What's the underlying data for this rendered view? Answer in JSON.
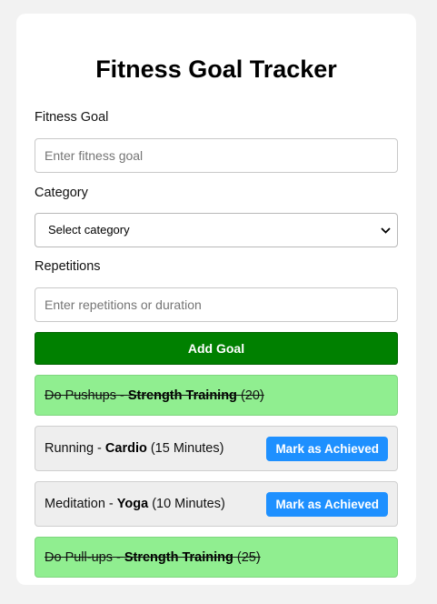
{
  "app": {
    "title": "Fitness Goal Tracker"
  },
  "form": {
    "goal_label": "Fitness Goal",
    "goal_placeholder": "Enter fitness goal",
    "goal_value": "",
    "category_label": "Category",
    "category_selected": "Select category",
    "repetitions_label": "Repetitions",
    "repetitions_placeholder": "Enter repetitions or duration",
    "repetitions_value": "",
    "add_button_label": "Add Goal"
  },
  "goals": [
    {
      "name": "Do Pushups",
      "sep": " - ",
      "category": "Strength Training",
      "amount": " (20)",
      "achieved": true,
      "action_label": ""
    },
    {
      "name": "Running",
      "sep": " - ",
      "category": "Cardio",
      "amount": " (15 Minutes)",
      "achieved": false,
      "action_label": "Mark as Achieved"
    },
    {
      "name": "Meditation",
      "sep": " - ",
      "category": "Yoga",
      "amount": " (10 Minutes)",
      "achieved": false,
      "action_label": "Mark as Achieved"
    },
    {
      "name": "Do Pull-ups",
      "sep": " - ",
      "category": "Strength Training",
      "amount": " (25)",
      "achieved": true,
      "action_label": ""
    }
  ],
  "colors": {
    "add_button": "#008000",
    "achieved_bg": "#90ee90",
    "pending_bg": "#eeeeee",
    "action_button": "#1e90ff"
  },
  "icons": {
    "select_arrow": "chevron-down-icon"
  }
}
